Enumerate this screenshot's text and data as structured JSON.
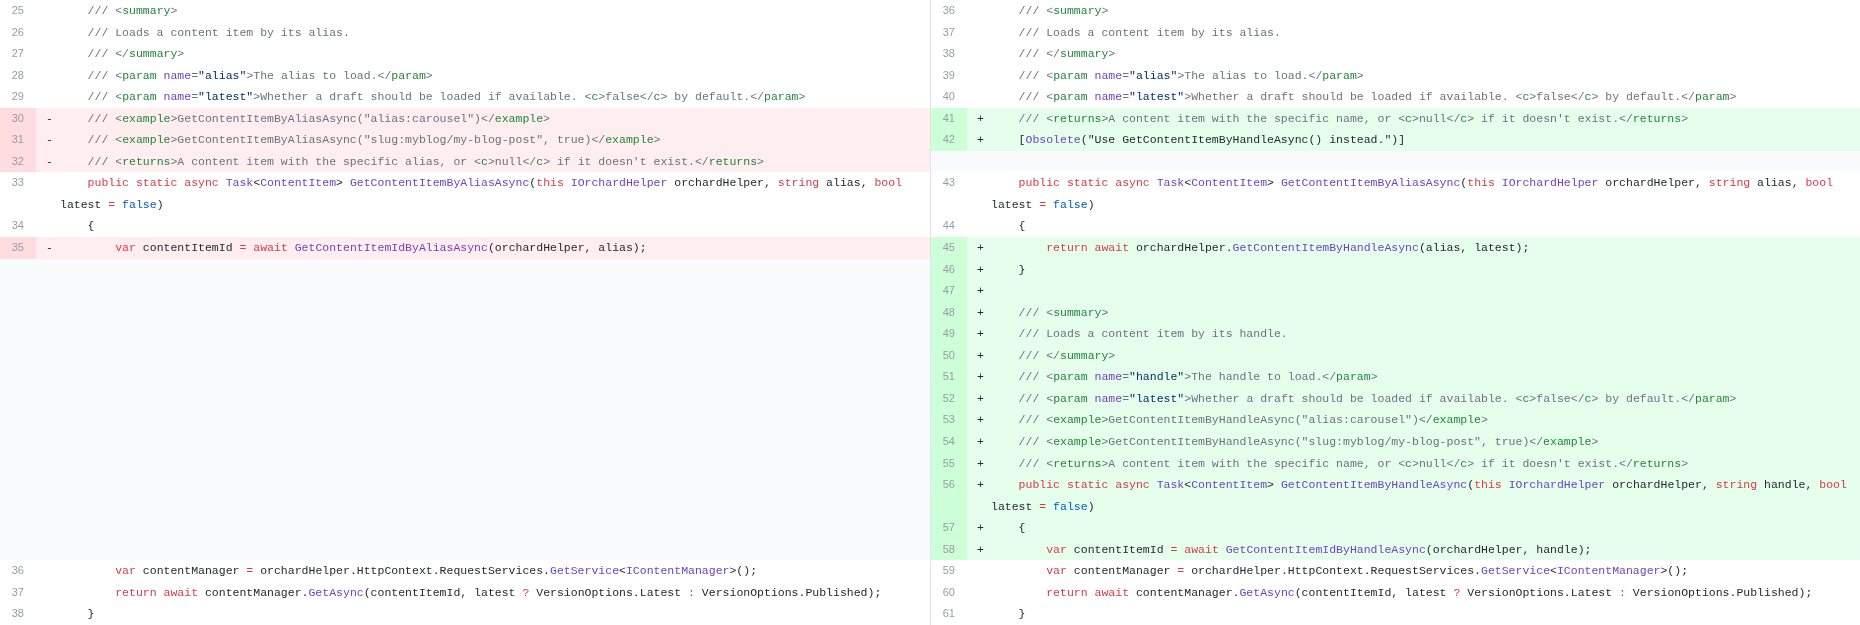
{
  "diff": {
    "rows": [
      {
        "left": {
          "kind": "context",
          "number": "25",
          "code": [
            {
              "kind": "cmt",
              "text": "    /// <"
            },
            {
              "kind": "tag",
              "text": "summary"
            },
            {
              "kind": "cmt",
              "text": ">"
            }
          ]
        },
        "right": {
          "kind": "context",
          "number": "36",
          "code": [
            {
              "kind": "cmt",
              "text": "    /// <"
            },
            {
              "kind": "tag",
              "text": "summary"
            },
            {
              "kind": "cmt",
              "text": ">"
            }
          ]
        }
      },
      {
        "left": {
          "kind": "context",
          "number": "26",
          "code": [
            {
              "kind": "cmt",
              "text": "    /// Loads a content item by its alias."
            }
          ]
        },
        "right": {
          "kind": "context",
          "number": "37",
          "code": [
            {
              "kind": "cmt",
              "text": "    /// Loads a content item by its alias."
            }
          ]
        }
      },
      {
        "left": {
          "kind": "context",
          "number": "27",
          "code": [
            {
              "kind": "cmt",
              "text": "    /// </"
            },
            {
              "kind": "tag",
              "text": "summary"
            },
            {
              "kind": "cmt",
              "text": ">"
            }
          ]
        },
        "right": {
          "kind": "context",
          "number": "38",
          "code": [
            {
              "kind": "cmt",
              "text": "    /// </"
            },
            {
              "kind": "tag",
              "text": "summary"
            },
            {
              "kind": "cmt",
              "text": ">"
            }
          ]
        }
      },
      {
        "left": {
          "kind": "context",
          "number": "28",
          "code": [
            {
              "kind": "cmt",
              "text": "    /// <"
            },
            {
              "kind": "tag",
              "text": "param"
            },
            {
              "kind": "attr",
              "text": " name"
            },
            {
              "kind": "cmt",
              "text": "="
            },
            {
              "kind": "str",
              "text": "\"alias\""
            },
            {
              "kind": "cmt",
              "text": ">The alias to load.</"
            },
            {
              "kind": "tag",
              "text": "param"
            },
            {
              "kind": "cmt",
              "text": ">"
            }
          ]
        },
        "right": {
          "kind": "context",
          "number": "39",
          "code": [
            {
              "kind": "cmt",
              "text": "    /// <"
            },
            {
              "kind": "tag",
              "text": "param"
            },
            {
              "kind": "attr",
              "text": " name"
            },
            {
              "kind": "cmt",
              "text": "="
            },
            {
              "kind": "str",
              "text": "\"alias\""
            },
            {
              "kind": "cmt",
              "text": ">The alias to load.</"
            },
            {
              "kind": "tag",
              "text": "param"
            },
            {
              "kind": "cmt",
              "text": ">"
            }
          ]
        }
      },
      {
        "left": {
          "kind": "context",
          "number": "29",
          "code": [
            {
              "kind": "cmt",
              "text": "    /// <"
            },
            {
              "kind": "tag",
              "text": "param"
            },
            {
              "kind": "attr",
              "text": " name"
            },
            {
              "kind": "cmt",
              "text": "="
            },
            {
              "kind": "str",
              "text": "\"latest\""
            },
            {
              "kind": "cmt",
              "text": ">Whether a draft should be loaded if available. <"
            },
            {
              "kind": "tag",
              "text": "c"
            },
            {
              "kind": "cmt",
              "text": ">false</"
            },
            {
              "kind": "tag",
              "text": "c"
            },
            {
              "kind": "cmt",
              "text": "> by default.</"
            },
            {
              "kind": "tag",
              "text": "param"
            },
            {
              "kind": "cmt",
              "text": ">"
            }
          ]
        },
        "right": {
          "kind": "context",
          "number": "40",
          "code": [
            {
              "kind": "cmt",
              "text": "    /// <"
            },
            {
              "kind": "tag",
              "text": "param"
            },
            {
              "kind": "attr",
              "text": " name"
            },
            {
              "kind": "cmt",
              "text": "="
            },
            {
              "kind": "str",
              "text": "\"latest\""
            },
            {
              "kind": "cmt",
              "text": ">Whether a draft should be loaded if available. <"
            },
            {
              "kind": "tag",
              "text": "c"
            },
            {
              "kind": "cmt",
              "text": ">false</"
            },
            {
              "kind": "tag",
              "text": "c"
            },
            {
              "kind": "cmt",
              "text": "> by default.</"
            },
            {
              "kind": "tag",
              "text": "param"
            },
            {
              "kind": "cmt",
              "text": ">"
            }
          ]
        }
      },
      {
        "left": {
          "kind": "removed",
          "number": "30",
          "marker": "-",
          "code": [
            {
              "kind": "cmt",
              "text": "    /// <"
            },
            {
              "kind": "tag",
              "text": "example"
            },
            {
              "kind": "cmt",
              "text": ">GetContentItemByAliasAsync(\"alias:carousel\")</"
            },
            {
              "kind": "tag",
              "text": "example"
            },
            {
              "kind": "cmt",
              "text": ">"
            }
          ]
        },
        "right": {
          "kind": "added",
          "number": "41",
          "marker": "+",
          "code": [
            {
              "kind": "cmt",
              "text": "    /// <"
            },
            {
              "kind": "tag",
              "text": "returns"
            },
            {
              "kind": "cmt",
              "text": ">A content item with the specific name, or <"
            },
            {
              "kind": "tag",
              "text": "c"
            },
            {
              "kind": "cmt",
              "text": ">null</"
            },
            {
              "kind": "tag",
              "text": "c"
            },
            {
              "kind": "cmt",
              "text": "> if it doesn't exist.</"
            },
            {
              "kind": "tag",
              "text": "returns"
            },
            {
              "kind": "cmt",
              "text": ">"
            }
          ]
        }
      },
      {
        "left": {
          "kind": "removed",
          "number": "31",
          "marker": "-",
          "code": [
            {
              "kind": "cmt",
              "text": "    /// <"
            },
            {
              "kind": "tag",
              "text": "example"
            },
            {
              "kind": "cmt",
              "text": ">GetContentItemByAliasAsync(\"slug:myblog/my-blog-post\", true)</"
            },
            {
              "kind": "tag",
              "text": "example"
            },
            {
              "kind": "cmt",
              "text": ">"
            }
          ]
        },
        "right": {
          "kind": "added",
          "number": "42",
          "marker": "+",
          "code": [
            {
              "kind": "txt",
              "text": "    ["
            },
            {
              "kind": "type",
              "text": "Obsolete"
            },
            {
              "kind": "txt",
              "text": "(\"Use GetContentItemByHandleAsync() instead.\")]"
            }
          ]
        }
      },
      {
        "left": {
          "kind": "removed",
          "number": "32",
          "marker": "-",
          "code": [
            {
              "kind": "cmt",
              "text": "    /// <"
            },
            {
              "kind": "tag",
              "text": "returns"
            },
            {
              "kind": "cmt",
              "text": ">A content item with the specific alias, or <"
            },
            {
              "kind": "tag",
              "text": "c"
            },
            {
              "kind": "cmt",
              "text": ">null</"
            },
            {
              "kind": "tag",
              "text": "c"
            },
            {
              "kind": "cmt",
              "text": "> if it doesn't exist.</"
            },
            {
              "kind": "tag",
              "text": "returns"
            },
            {
              "kind": "cmt",
              "text": ">"
            }
          ]
        }
      },
      {
        "left": {
          "kind": "context",
          "number": "33",
          "code": [
            {
              "kind": "kw",
              "text": "    public static async "
            },
            {
              "kind": "type",
              "text": "Task"
            },
            {
              "kind": "txt",
              "text": "<"
            },
            {
              "kind": "type",
              "text": "ContentItem"
            },
            {
              "kind": "txt",
              "text": "> "
            },
            {
              "kind": "fn",
              "text": "GetContentItemByAliasAsync"
            },
            {
              "kind": "txt",
              "text": "("
            },
            {
              "kind": "kw",
              "text": "this "
            },
            {
              "kind": "type",
              "text": "IOrchardHelper"
            },
            {
              "kind": "txt",
              "text": " orchardHelper, "
            },
            {
              "kind": "kw",
              "text": "string"
            },
            {
              "kind": "txt",
              "text": " alias, "
            },
            {
              "kind": "kw",
              "text": "bool"
            },
            {
              "kind": "txt",
              "text": " latest "
            },
            {
              "kind": "kw",
              "text": "="
            },
            {
              "kind": "lit",
              "text": " false"
            },
            {
              "kind": "txt",
              "text": ")"
            }
          ]
        },
        "right": {
          "kind": "context",
          "number": "43",
          "code": [
            {
              "kind": "kw",
              "text": "    public static async "
            },
            {
              "kind": "type",
              "text": "Task"
            },
            {
              "kind": "txt",
              "text": "<"
            },
            {
              "kind": "type",
              "text": "ContentItem"
            },
            {
              "kind": "txt",
              "text": "> "
            },
            {
              "kind": "fn",
              "text": "GetContentItemByAliasAsync"
            },
            {
              "kind": "txt",
              "text": "("
            },
            {
              "kind": "kw",
              "text": "this "
            },
            {
              "kind": "type",
              "text": "IOrchardHelper"
            },
            {
              "kind": "txt",
              "text": " orchardHelper, "
            },
            {
              "kind": "kw",
              "text": "string"
            },
            {
              "kind": "txt",
              "text": " alias, "
            },
            {
              "kind": "kw",
              "text": "bool"
            },
            {
              "kind": "txt",
              "text": " latest "
            },
            {
              "kind": "kw",
              "text": "="
            },
            {
              "kind": "lit",
              "text": " false"
            },
            {
              "kind": "txt",
              "text": ")"
            }
          ]
        }
      },
      {
        "left": {
          "kind": "context",
          "number": "34",
          "code": [
            {
              "kind": "txt",
              "text": "    {"
            }
          ]
        },
        "right": {
          "kind": "context",
          "number": "44",
          "code": [
            {
              "kind": "txt",
              "text": "    {"
            }
          ]
        }
      },
      {
        "left": {
          "kind": "removed",
          "number": "35",
          "marker": "-",
          "code": [
            {
              "kind": "kw",
              "text": "        var"
            },
            {
              "kind": "txt",
              "text": " contentItemId "
            },
            {
              "kind": "kw",
              "text": "= await "
            },
            {
              "kind": "fn",
              "text": "GetContentItemIdByAliasAsync"
            },
            {
              "kind": "txt",
              "text": "(orchardHelper, alias);"
            }
          ]
        },
        "right": {
          "kind": "added",
          "number": "45",
          "marker": "+",
          "code": [
            {
              "kind": "kw",
              "text": "        return await"
            },
            {
              "kind": "txt",
              "text": " orchardHelper."
            },
            {
              "kind": "fn",
              "text": "GetContentItemByHandleAsync"
            },
            {
              "kind": "txt",
              "text": "(alias, latest);"
            }
          ]
        }
      },
      {
        "right": {
          "kind": "added",
          "number": "46",
          "marker": "+",
          "code": [
            {
              "kind": "txt",
              "text": "    }"
            }
          ]
        }
      },
      {
        "right": {
          "kind": "added",
          "number": "47",
          "marker": "+"
        }
      },
      {
        "right": {
          "kind": "added",
          "number": "48",
          "marker": "+",
          "code": [
            {
              "kind": "cmt",
              "text": "    /// <"
            },
            {
              "kind": "tag",
              "text": "summary"
            },
            {
              "kind": "cmt",
              "text": ">"
            }
          ]
        }
      },
      {
        "right": {
          "kind": "added",
          "number": "49",
          "marker": "+",
          "code": [
            {
              "kind": "cmt",
              "text": "    /// Loads a content item by its handle."
            }
          ]
        }
      },
      {
        "right": {
          "kind": "added",
          "number": "50",
          "marker": "+",
          "code": [
            {
              "kind": "cmt",
              "text": "    /// </"
            },
            {
              "kind": "tag",
              "text": "summary"
            },
            {
              "kind": "cmt",
              "text": ">"
            }
          ]
        }
      },
      {
        "right": {
          "kind": "added",
          "number": "51",
          "marker": "+",
          "code": [
            {
              "kind": "cmt",
              "text": "    /// <"
            },
            {
              "kind": "tag",
              "text": "param"
            },
            {
              "kind": "attr",
              "text": " name"
            },
            {
              "kind": "cmt",
              "text": "="
            },
            {
              "kind": "str",
              "text": "\"handle\""
            },
            {
              "kind": "cmt",
              "text": ">The handle to load.</"
            },
            {
              "kind": "tag",
              "text": "param"
            },
            {
              "kind": "cmt",
              "text": ">"
            }
          ]
        }
      },
      {
        "right": {
          "kind": "added",
          "number": "52",
          "marker": "+",
          "code": [
            {
              "kind": "cmt",
              "text": "    /// <"
            },
            {
              "kind": "tag",
              "text": "param"
            },
            {
              "kind": "attr",
              "text": " name"
            },
            {
              "kind": "cmt",
              "text": "="
            },
            {
              "kind": "str",
              "text": "\"latest\""
            },
            {
              "kind": "cmt",
              "text": ">Whether a draft should be loaded if available. <"
            },
            {
              "kind": "tag",
              "text": "c"
            },
            {
              "kind": "cmt",
              "text": ">false</"
            },
            {
              "kind": "tag",
              "text": "c"
            },
            {
              "kind": "cmt",
              "text": "> by default.</"
            },
            {
              "kind": "tag",
              "text": "param"
            },
            {
              "kind": "cmt",
              "text": ">"
            }
          ]
        }
      },
      {
        "right": {
          "kind": "added",
          "number": "53",
          "marker": "+",
          "code": [
            {
              "kind": "cmt",
              "text": "    /// <"
            },
            {
              "kind": "tag",
              "text": "example"
            },
            {
              "kind": "cmt",
              "text": ">GetContentItemByHandleAsync(\"alias:carousel\")</"
            },
            {
              "kind": "tag",
              "text": "example"
            },
            {
              "kind": "cmt",
              "text": ">"
            }
          ]
        }
      },
      {
        "right": {
          "kind": "added",
          "number": "54",
          "marker": "+",
          "code": [
            {
              "kind": "cmt",
              "text": "    /// <"
            },
            {
              "kind": "tag",
              "text": "example"
            },
            {
              "kind": "cmt",
              "text": ">GetContentItemByHandleAsync(\"slug:myblog/my-blog-post\", true)</"
            },
            {
              "kind": "tag",
              "text": "example"
            },
            {
              "kind": "cmt",
              "text": ">"
            }
          ]
        }
      },
      {
        "right": {
          "kind": "added",
          "number": "55",
          "marker": "+",
          "code": [
            {
              "kind": "cmt",
              "text": "    /// <"
            },
            {
              "kind": "tag",
              "text": "returns"
            },
            {
              "kind": "cmt",
              "text": ">A content item with the specific name, or <"
            },
            {
              "kind": "tag",
              "text": "c"
            },
            {
              "kind": "cmt",
              "text": ">null</"
            },
            {
              "kind": "tag",
              "text": "c"
            },
            {
              "kind": "cmt",
              "text": "> if it doesn't exist.</"
            },
            {
              "kind": "tag",
              "text": "returns"
            },
            {
              "kind": "cmt",
              "text": ">"
            }
          ]
        }
      },
      {
        "right": {
          "kind": "added",
          "number": "56",
          "marker": "+",
          "code": [
            {
              "kind": "kw",
              "text": "    public static async "
            },
            {
              "kind": "type",
              "text": "Task"
            },
            {
              "kind": "txt",
              "text": "<"
            },
            {
              "kind": "type",
              "text": "ContentItem"
            },
            {
              "kind": "txt",
              "text": "> "
            },
            {
              "kind": "fn",
              "text": "GetContentItemByHandleAsync"
            },
            {
              "kind": "txt",
              "text": "("
            },
            {
              "kind": "kw",
              "text": "this "
            },
            {
              "kind": "type",
              "text": "IOrchardHelper"
            },
            {
              "kind": "txt",
              "text": " orchardHelper, "
            },
            {
              "kind": "kw",
              "text": "string"
            },
            {
              "kind": "txt",
              "text": " handle, "
            },
            {
              "kind": "kw",
              "text": "bool"
            },
            {
              "kind": "txt",
              "text": " latest "
            },
            {
              "kind": "kw",
              "text": "="
            },
            {
              "kind": "lit",
              "text": " false"
            },
            {
              "kind": "txt",
              "text": ")"
            }
          ]
        }
      },
      {
        "right": {
          "kind": "added",
          "number": "57",
          "marker": "+",
          "code": [
            {
              "kind": "txt",
              "text": "    {"
            }
          ]
        }
      },
      {
        "right": {
          "kind": "added",
          "number": "58",
          "marker": "+",
          "code": [
            {
              "kind": "kw",
              "text": "        var"
            },
            {
              "kind": "txt",
              "text": " contentItemId "
            },
            {
              "kind": "kw",
              "text": "= await "
            },
            {
              "kind": "fn",
              "text": "GetContentItemIdByHandleAsync"
            },
            {
              "kind": "txt",
              "text": "(orchardHelper, handle);"
            }
          ]
        }
      },
      {
        "left": {
          "kind": "context",
          "number": "36",
          "code": [
            {
              "kind": "kw",
              "text": "        var"
            },
            {
              "kind": "txt",
              "text": " contentManager "
            },
            {
              "kind": "kw",
              "text": "="
            },
            {
              "kind": "txt",
              "text": " orchardHelper.HttpContext.RequestServices."
            },
            {
              "kind": "fn",
              "text": "GetService"
            },
            {
              "kind": "txt",
              "text": "<"
            },
            {
              "kind": "type",
              "text": "IContentManager"
            },
            {
              "kind": "txt",
              "text": ">();"
            }
          ]
        },
        "right": {
          "kind": "context",
          "number": "59",
          "code": [
            {
              "kind": "kw",
              "text": "        var"
            },
            {
              "kind": "txt",
              "text": " contentManager "
            },
            {
              "kind": "kw",
              "text": "="
            },
            {
              "kind": "txt",
              "text": " orchardHelper.HttpContext.RequestServices."
            },
            {
              "kind": "fn",
              "text": "GetService"
            },
            {
              "kind": "txt",
              "text": "<"
            },
            {
              "kind": "type",
              "text": "IContentManager"
            },
            {
              "kind": "txt",
              "text": ">();"
            }
          ]
        }
      },
      {
        "left": {
          "kind": "context",
          "number": "37",
          "code": [
            {
              "kind": "kw",
              "text": "        return await"
            },
            {
              "kind": "txt",
              "text": " contentManager."
            },
            {
              "kind": "fn",
              "text": "GetAsync"
            },
            {
              "kind": "txt",
              "text": "(contentItemId, latest "
            },
            {
              "kind": "kw",
              "text": "?"
            },
            {
              "kind": "txt",
              "text": " VersionOptions.Latest "
            },
            {
              "kind": "kw",
              "text": ":"
            },
            {
              "kind": "txt",
              "text": " VersionOptions.Published);"
            }
          ]
        },
        "right": {
          "kind": "context",
          "number": "60",
          "code": [
            {
              "kind": "kw",
              "text": "        return await"
            },
            {
              "kind": "txt",
              "text": " contentManager."
            },
            {
              "kind": "fn",
              "text": "GetAsync"
            },
            {
              "kind": "txt",
              "text": "(contentItemId, latest "
            },
            {
              "kind": "kw",
              "text": "?"
            },
            {
              "kind": "txt",
              "text": " VersionOptions.Latest "
            },
            {
              "kind": "kw",
              "text": ":"
            },
            {
              "kind": "txt",
              "text": " VersionOptions.Published);"
            }
          ]
        }
      },
      {
        "left": {
          "kind": "context",
          "number": "38",
          "code": [
            {
              "kind": "txt",
              "text": "    }"
            }
          ]
        },
        "right": {
          "kind": "context",
          "number": "61",
          "code": [
            {
              "kind": "txt",
              "text": "    }"
            }
          ]
        }
      }
    ]
  }
}
